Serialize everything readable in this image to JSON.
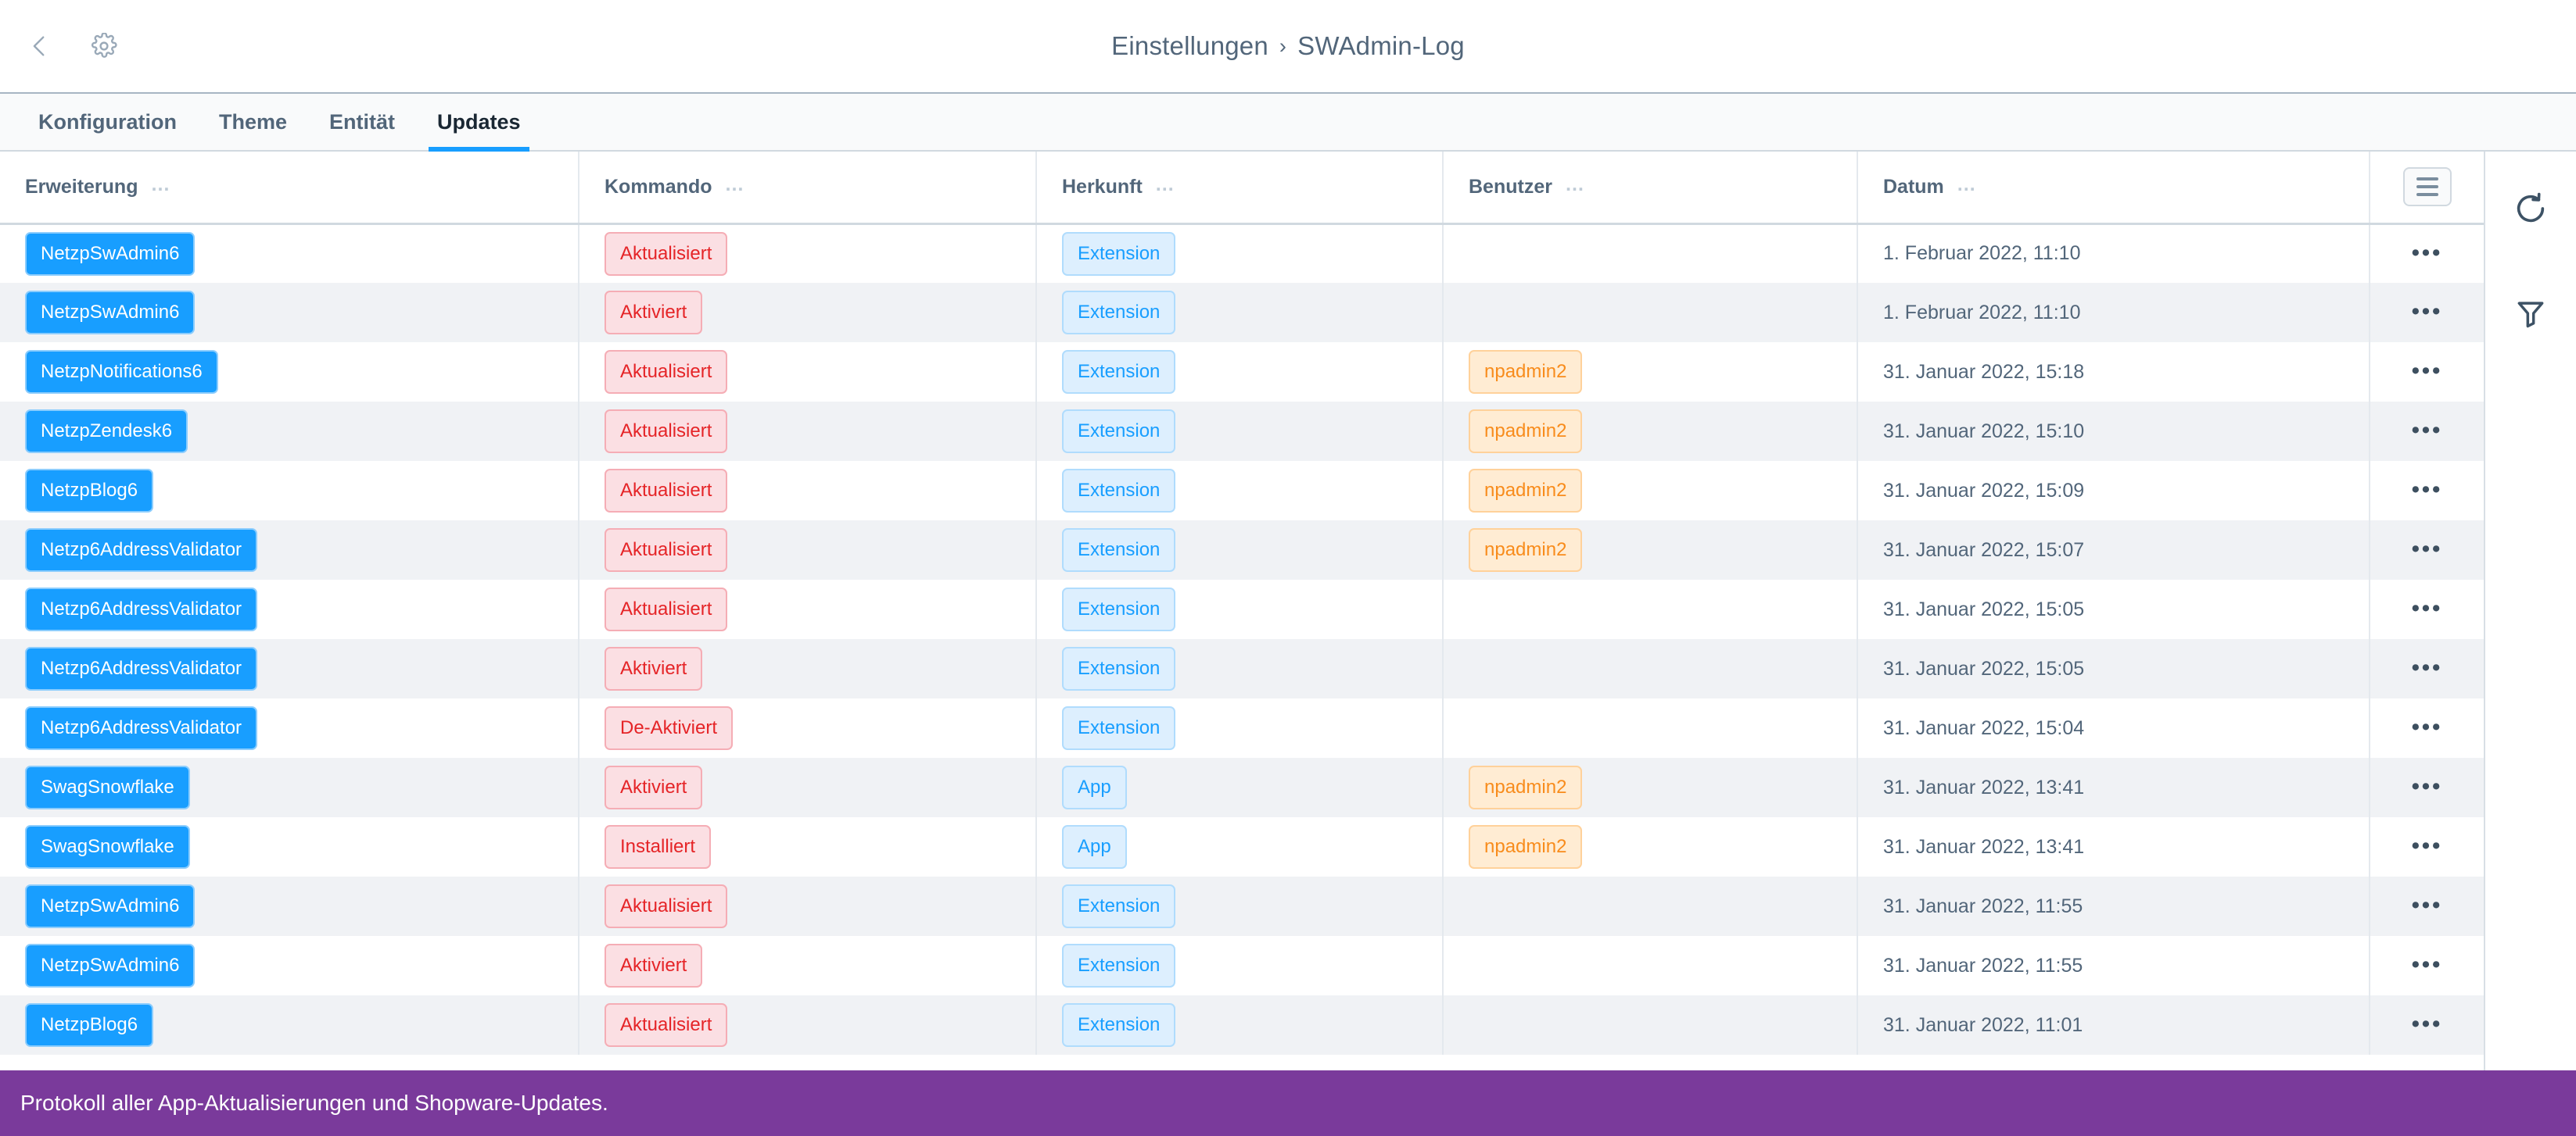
{
  "topbar": {
    "back_icon": "chevron-left-icon",
    "settings_icon": "gear-icon",
    "breadcrumb_parent": "Einstellungen",
    "breadcrumb_separator": "›",
    "breadcrumb_current": "SWAdmin-Log"
  },
  "tabs": [
    {
      "label": "Konfiguration",
      "active": false
    },
    {
      "label": "Theme",
      "active": false
    },
    {
      "label": "Entität",
      "active": false
    },
    {
      "label": "Updates",
      "active": true
    }
  ],
  "rail": {
    "refresh_icon": "refresh-icon",
    "filter_icon": "filter-icon"
  },
  "table": {
    "columns": [
      {
        "label": "Erweiterung",
        "menu": "…"
      },
      {
        "label": "Kommando",
        "menu": "…"
      },
      {
        "label": "Herkunft",
        "menu": "…"
      },
      {
        "label": "Benutzer",
        "menu": "…"
      },
      {
        "label": "Datum",
        "menu": "…"
      }
    ],
    "settings_icon": "table-settings-icon",
    "row_menu_glyph": "•••",
    "rows": [
      {
        "extension": "NetzpSwAdmin6",
        "command": "Aktualisiert",
        "source": "Extension",
        "user": "",
        "date": "1. Februar 2022, 11:10"
      },
      {
        "extension": "NetzpSwAdmin6",
        "command": "Aktiviert",
        "source": "Extension",
        "user": "",
        "date": "1. Februar 2022, 11:10"
      },
      {
        "extension": "NetzpNotifications6",
        "command": "Aktualisiert",
        "source": "Extension",
        "user": "npadmin2",
        "date": "31. Januar 2022, 15:18"
      },
      {
        "extension": "NetzpZendesk6",
        "command": "Aktualisiert",
        "source": "Extension",
        "user": "npadmin2",
        "date": "31. Januar 2022, 15:10"
      },
      {
        "extension": "NetzpBlog6",
        "command": "Aktualisiert",
        "source": "Extension",
        "user": "npadmin2",
        "date": "31. Januar 2022, 15:09"
      },
      {
        "extension": "Netzp6AddressValidator",
        "command": "Aktualisiert",
        "source": "Extension",
        "user": "npadmin2",
        "date": "31. Januar 2022, 15:07"
      },
      {
        "extension": "Netzp6AddressValidator",
        "command": "Aktualisiert",
        "source": "Extension",
        "user": "",
        "date": "31. Januar 2022, 15:05"
      },
      {
        "extension": "Netzp6AddressValidator",
        "command": "Aktiviert",
        "source": "Extension",
        "user": "",
        "date": "31. Januar 2022, 15:05"
      },
      {
        "extension": "Netzp6AddressValidator",
        "command": "De-Aktiviert",
        "source": "Extension",
        "user": "",
        "date": "31. Januar 2022, 15:04"
      },
      {
        "extension": "SwagSnowflake",
        "command": "Aktiviert",
        "source": "App",
        "user": "npadmin2",
        "date": "31. Januar 2022, 13:41"
      },
      {
        "extension": "SwagSnowflake",
        "command": "Installiert",
        "source": "App",
        "user": "npadmin2",
        "date": "31. Januar 2022, 13:41"
      },
      {
        "extension": "NetzpSwAdmin6",
        "command": "Aktualisiert",
        "source": "Extension",
        "user": "",
        "date": "31. Januar 2022, 11:55"
      },
      {
        "extension": "NetzpSwAdmin6",
        "command": "Aktiviert",
        "source": "Extension",
        "user": "",
        "date": "31. Januar 2022, 11:55"
      },
      {
        "extension": "NetzpBlog6",
        "command": "Aktualisiert",
        "source": "Extension",
        "user": "",
        "date": "31. Januar 2022, 11:01"
      }
    ]
  },
  "hint_bar": {
    "text": "Protokoll aller App-Aktualisierungen und Shopware-Updates.",
    "color": "#7a3a9b"
  },
  "colors": {
    "accent": "#189eff",
    "badge_extension_bg": "#189eff",
    "badge_command_bg": "#fbdfe3",
    "badge_command_fg": "#e52427",
    "badge_source_bg": "#ddeffe",
    "badge_source_fg": "#189eff",
    "badge_user_bg": "#ffecd3",
    "badge_user_fg": "#f88c1c",
    "text": "#52667a",
    "row_alt_bg": "#f0f2f5"
  }
}
